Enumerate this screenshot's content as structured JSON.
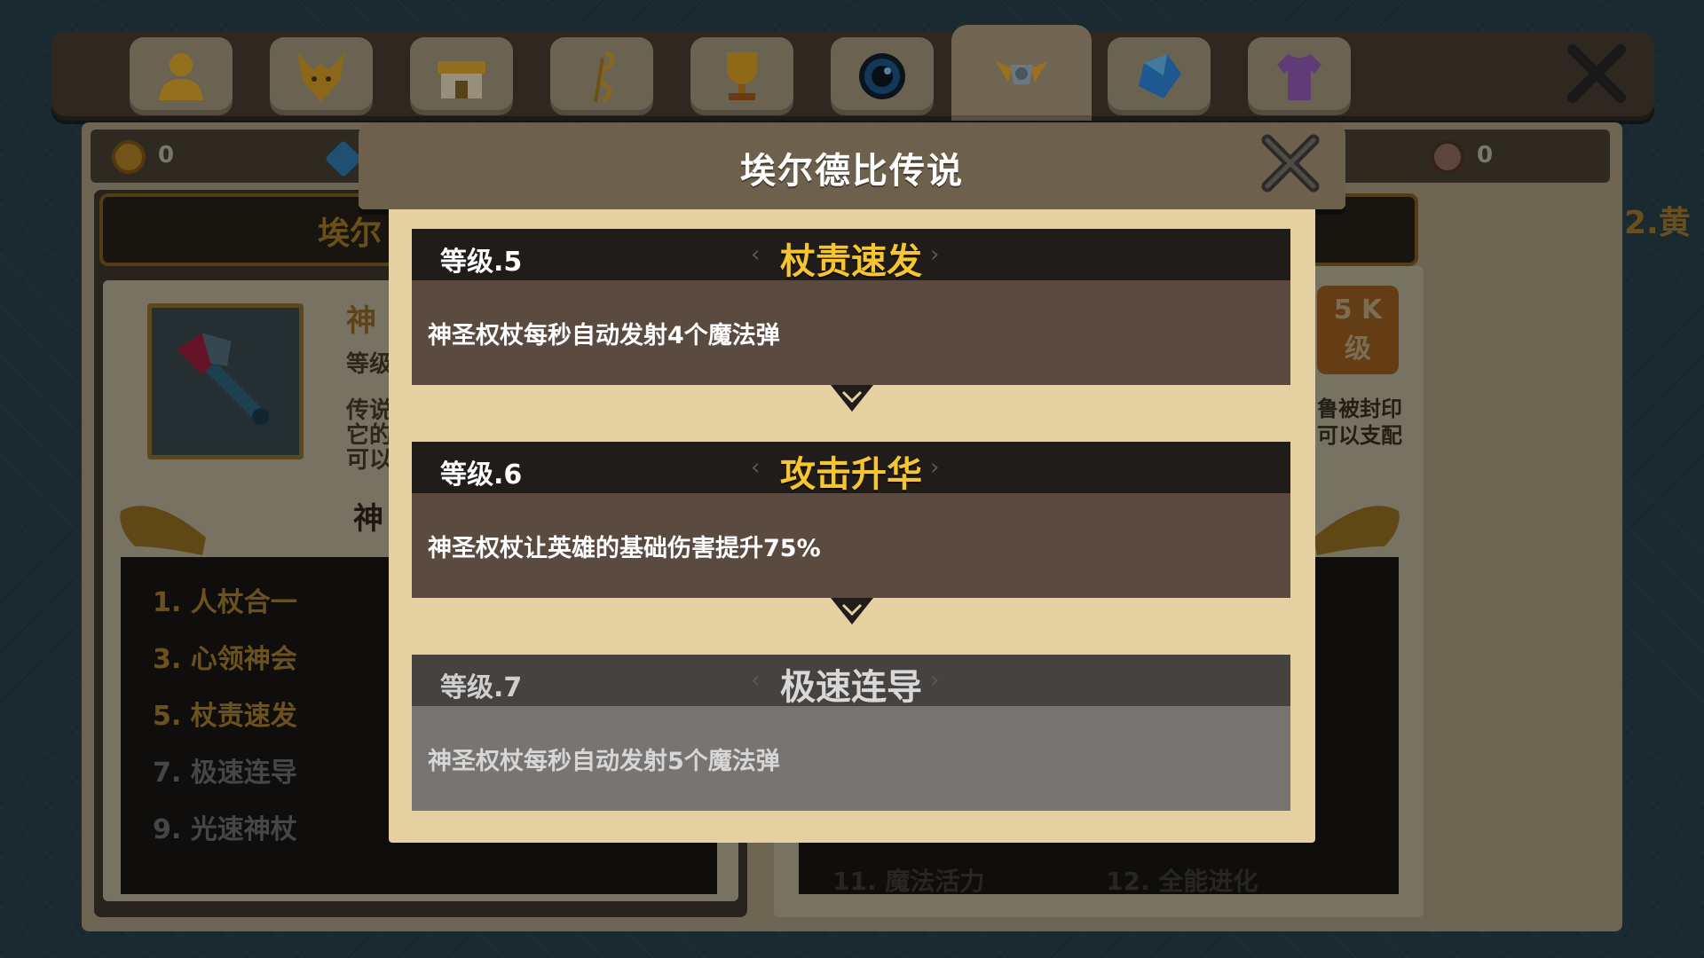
{
  "top_tabs": [
    {
      "name": "hero-tab",
      "icon": "person-icon"
    },
    {
      "name": "mount-tab",
      "icon": "dragon-head-icon"
    },
    {
      "name": "shop-tab",
      "icon": "shop-icon"
    },
    {
      "name": "skill-tab",
      "icon": "serpent-staff-icon"
    },
    {
      "name": "trophy-tab",
      "icon": "trophy-icon"
    },
    {
      "name": "orb-tab",
      "icon": "dark-orb-icon"
    },
    {
      "name": "relic-tab",
      "icon": "winged-crest-icon",
      "active": true
    },
    {
      "name": "gem-tab",
      "icon": "blue-gem-icon"
    },
    {
      "name": "costume-tab",
      "icon": "shirt-icon"
    }
  ],
  "currency": {
    "gold": "0",
    "relic_points": "0"
  },
  "background": {
    "title_partial": "埃尔",
    "item_name_partial": "神",
    "level_partial": "等级",
    "desc_partial": [
      "传说",
      "它的",
      "可以"
    ],
    "section_partial": "神",
    "skills": [
      {
        "label": "1. 人杖合一",
        "unlocked": true
      },
      {
        "label": "3. 心领神会",
        "unlocked": true
      },
      {
        "label": "5. 杖责速发",
        "unlocked": true
      },
      {
        "label": "7. 极速连导",
        "unlocked": false
      },
      {
        "label": "9. 光速神杖",
        "unlocked": false
      }
    ],
    "right_skills_partial": [
      "11. 魔法活力",
      "12. 全能进化"
    ],
    "orange_button": [
      "5 K",
      "级"
    ],
    "right_desc_partial": [
      "鲁被封印",
      "可以支配"
    ],
    "side_label": "2.黄"
  },
  "modal": {
    "title": "埃尔德比传说",
    "levels": [
      {
        "level": "等级.5",
        "name": "杖责速发",
        "desc": "神圣权杖每秒自动发射4个魔法弹",
        "unlocked": true
      },
      {
        "level": "等级.6",
        "name": "攻击升华",
        "desc": "神圣权杖让英雄的基础伤害提升75%",
        "unlocked": true
      },
      {
        "level": "等级.7",
        "name": "极速连导",
        "desc": "神圣权杖每秒自动发射5个魔法弹",
        "unlocked": false
      }
    ]
  },
  "colors": {
    "accent_gold": "#f7c52f",
    "modal_header": "#6d604c",
    "modal_body": "#e5d0a1",
    "card_body": "#5a4a40",
    "locked_body": "#777472"
  }
}
